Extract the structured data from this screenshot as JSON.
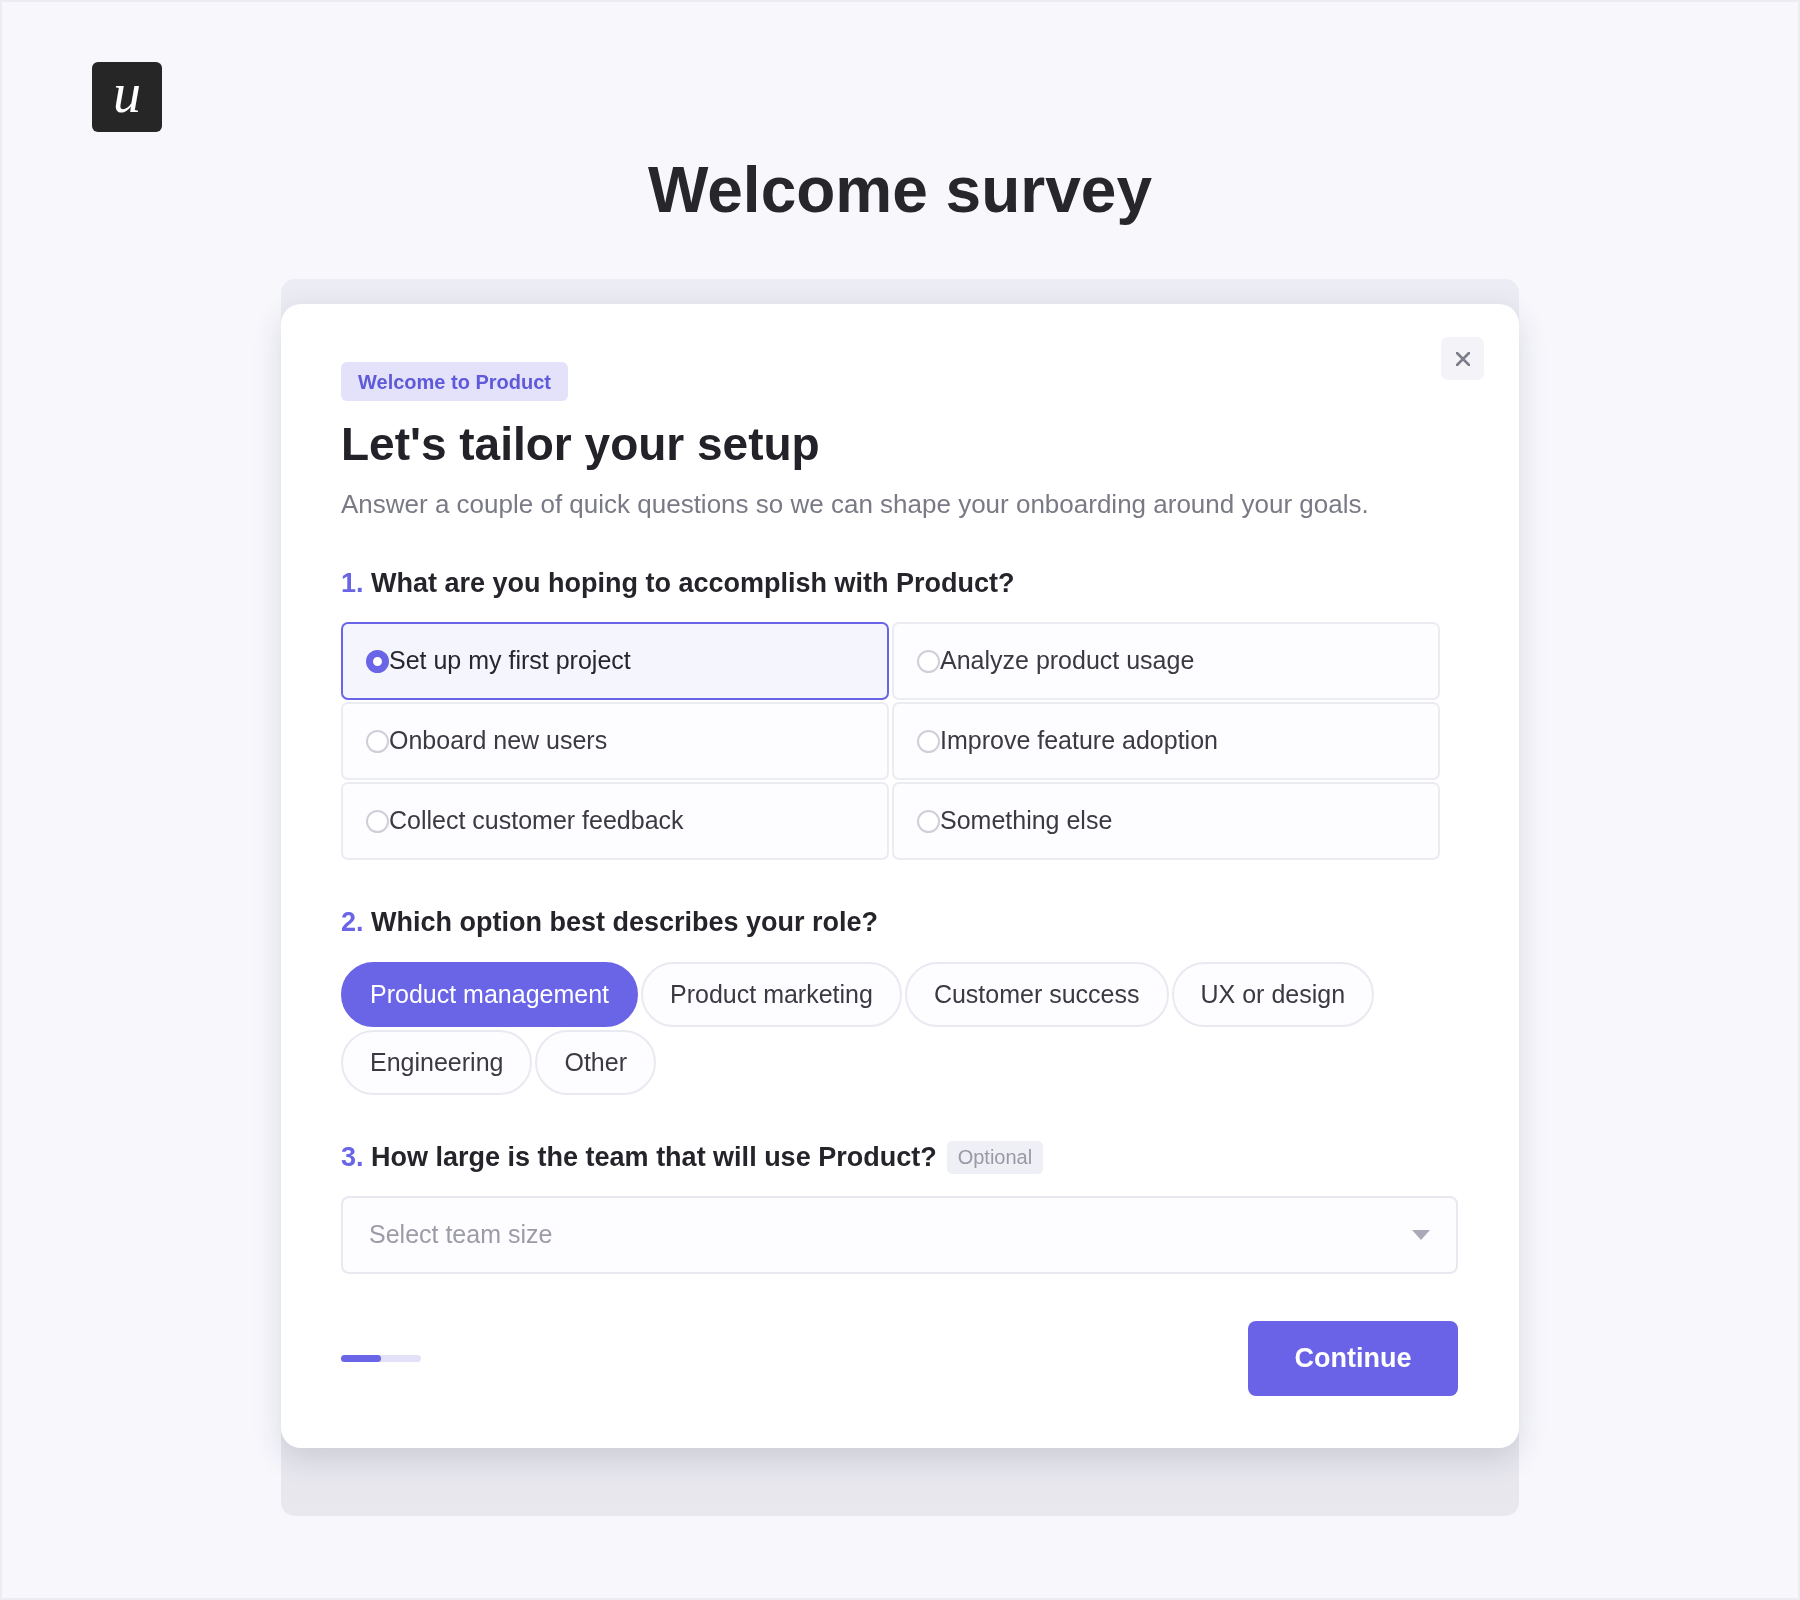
{
  "logo": {
    "text": "u"
  },
  "page_title": "Welcome survey",
  "dialog": {
    "badge": "Welcome to Product",
    "title": "Let's tailor your setup",
    "subtitle": "Answer a couple of quick questions so we can shape your onboarding around your goals.",
    "questions": [
      {
        "kind": "choice_grid",
        "number": "1.",
        "text": "What are you hoping to accomplish with Product?",
        "options": [
          {
            "label": "Set up my first project",
            "selected": true
          },
          {
            "label": "Analyze product usage",
            "selected": false
          },
          {
            "label": "Onboard new users",
            "selected": false
          },
          {
            "label": "Improve feature adoption",
            "selected": false
          },
          {
            "label": "Collect customer feedback",
            "selected": false
          },
          {
            "label": "Something else",
            "selected": false
          }
        ]
      },
      {
        "kind": "pill_group",
        "number": "2.",
        "text": "Which option best describes your role?",
        "options": [
          {
            "label": "Product management",
            "selected": true
          },
          {
            "label": "Product marketing",
            "selected": false
          },
          {
            "label": "Customer success",
            "selected": false
          },
          {
            "label": "UX or design",
            "selected": false
          },
          {
            "label": "Engineering",
            "selected": false
          },
          {
            "label": "Other",
            "selected": false
          }
        ]
      },
      {
        "kind": "dropdown",
        "number": "3.",
        "text": "How large is the team that will use Product?",
        "tag": "Optional",
        "placeholder": "Select team size"
      }
    ],
    "progress": {
      "level": 0.5
    },
    "continue_button": "Continue"
  }
}
